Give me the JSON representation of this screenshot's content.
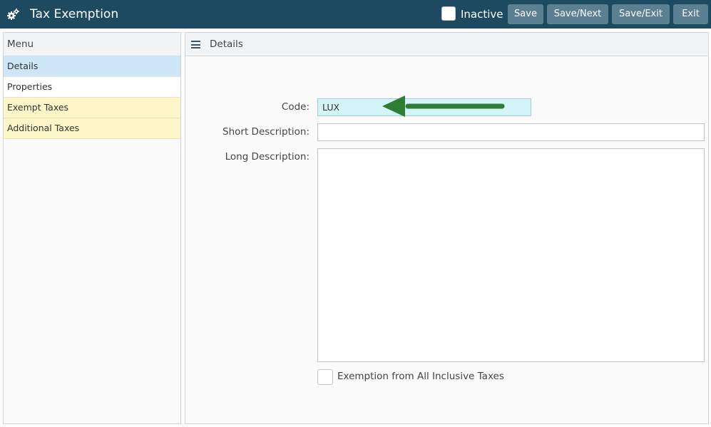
{
  "header": {
    "app_icon": "gears-icon",
    "title": "Tax Exemption",
    "inactive_label": "Inactive",
    "buttons": {
      "save": "Save",
      "save_next": "Save/Next",
      "save_exit": "Save/Exit",
      "exit": "Exit"
    },
    "colors": {
      "bar": "#1e4a61",
      "button": "#5b7f93"
    }
  },
  "menu": {
    "header": "Menu",
    "items": [
      {
        "label": "Details",
        "state": "active"
      },
      {
        "label": "Properties",
        "state": "normal"
      },
      {
        "label": "Exempt Taxes",
        "state": "highlighted"
      },
      {
        "label": "Additional Taxes",
        "state": "highlighted"
      }
    ]
  },
  "details": {
    "header_icon": "hamburger-icon",
    "header": "Details",
    "code_label": "Code:",
    "code_value": "LUX",
    "short_desc_label": "Short Description:",
    "short_desc_value": "",
    "long_desc_label": "Long Description:",
    "long_desc_value": "",
    "exempt_all_inclusive_label": "Exemption from All Inclusive Taxes",
    "exempt_all_inclusive_checked": false
  },
  "annotation": {
    "icon": "green-arrow-icon",
    "color": "#2e7d32"
  }
}
